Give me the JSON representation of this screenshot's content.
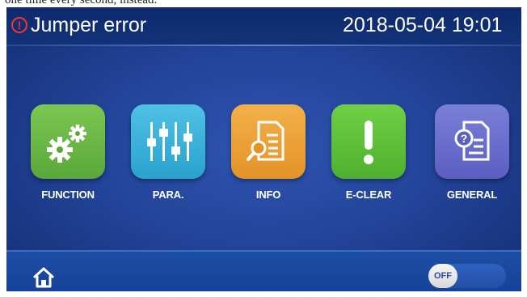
{
  "caption_fragment": "one time every second, instead.",
  "status_bar": {
    "error_icon": "exclamation-circle-icon",
    "error_title": "Jumper error",
    "datetime": "2018-05-04 19:01"
  },
  "menu": {
    "items": [
      {
        "label": "FUNCTION",
        "icon": "gears-icon",
        "color": "#6bbb47"
      },
      {
        "label": "PARA.",
        "icon": "sliders-icon",
        "color": "#3cb4dc"
      },
      {
        "label": "INFO",
        "icon": "document-search-icon",
        "color": "#eda13a"
      },
      {
        "label": "E-CLEAR",
        "icon": "exclamation-icon",
        "color": "#5ec03a"
      },
      {
        "label": "GENERAL",
        "icon": "help-document-icon",
        "color": "#6a6fcc"
      }
    ]
  },
  "bottom_bar": {
    "home_icon": "home-icon",
    "toggle": {
      "label": "OFF",
      "state": "off"
    }
  },
  "colors": {
    "error": "#e83a2f",
    "background": "#23459b"
  }
}
